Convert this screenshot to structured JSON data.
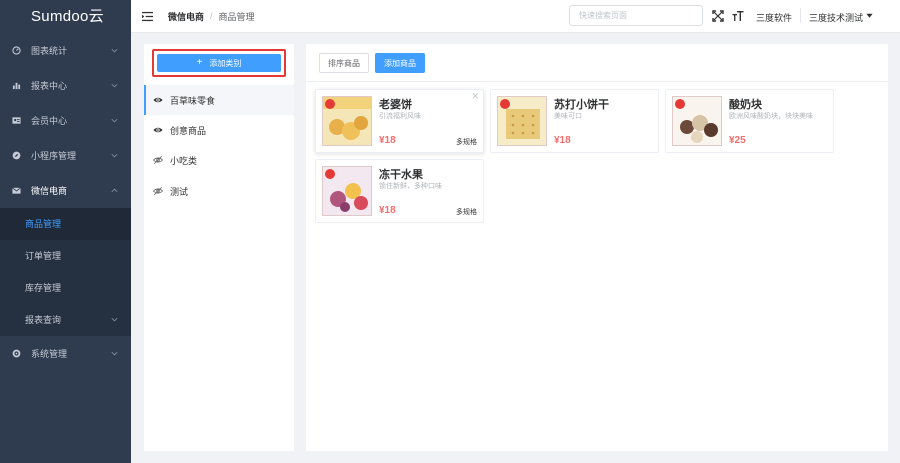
{
  "app": {
    "logo": "Sumdoo云"
  },
  "sidebar": {
    "items": [
      {
        "label": "图表统计",
        "icon": "gauge-icon"
      },
      {
        "label": "报表中心",
        "icon": "bar-chart-icon"
      },
      {
        "label": "会员中心",
        "icon": "id-card-icon"
      },
      {
        "label": "小程序管理",
        "icon": "compass-icon"
      },
      {
        "label": "微信电商",
        "icon": "mail-icon",
        "expanded": true
      },
      {
        "label": "系统管理",
        "icon": "gear-icon"
      }
    ],
    "submenu": [
      {
        "label": "商品管理",
        "active": true
      },
      {
        "label": "订单管理"
      },
      {
        "label": "库存管理"
      },
      {
        "label": "报表查询"
      }
    ]
  },
  "header": {
    "breadcrumb_root": "微信电商",
    "breadcrumb_sep": "/",
    "breadcrumb_current": "商品管理",
    "search_placeholder": "快速搜索页面",
    "company": "三度软件",
    "user": "三度技术测试"
  },
  "categories": {
    "add_label": "添加类别",
    "items": [
      {
        "label": "百草味零食",
        "visible": true,
        "active": true
      },
      {
        "label": "创意商品",
        "visible": true
      },
      {
        "label": "小吃类",
        "visible": false
      },
      {
        "label": "测试",
        "visible": false
      }
    ]
  },
  "toolbar": {
    "sort_label": "排序商品",
    "add_label": "添加商品"
  },
  "products": [
    {
      "name": "老婆饼",
      "desc": "引流福利风味",
      "price": "¥18",
      "spec": "多规格"
    },
    {
      "name": "苏打小饼干",
      "desc": "美味可口",
      "price": "¥18"
    },
    {
      "name": "酸奶块",
      "desc": "欧洲风味酸奶块，块块美味",
      "price": "¥25"
    },
    {
      "name": "冻干水果",
      "desc": "锁住新鲜，多种口味",
      "price": "¥18",
      "spec": "多规格"
    }
  ],
  "colors": {
    "accent": "#409eff",
    "price": "#f56c6c",
    "sidebar_bg": "#2f3b4e",
    "highlight_border": "#e53935"
  }
}
